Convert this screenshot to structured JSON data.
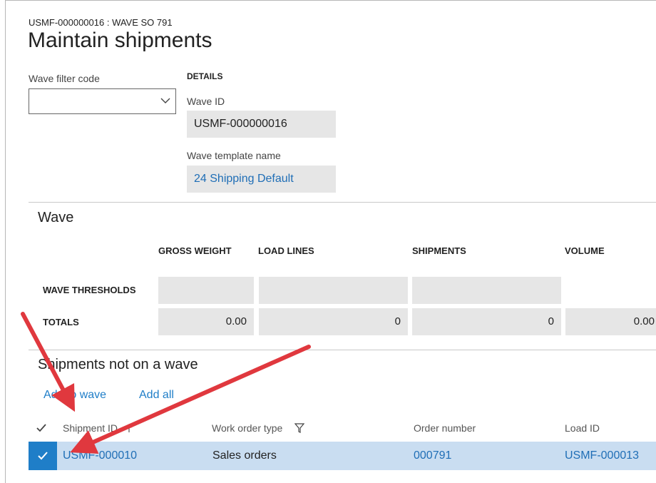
{
  "header": {
    "breadcrumb": "USMF-000000016 : WAVE SO 791",
    "title": "Maintain shipments"
  },
  "filter": {
    "label": "Wave filter code",
    "value": ""
  },
  "details": {
    "heading": "DETAILS",
    "wave_id_label": "Wave ID",
    "wave_id_value": "USMF-000000016",
    "template_label": "Wave template name",
    "template_value": "24 Shipping Default"
  },
  "wave": {
    "title": "Wave",
    "columns": [
      "GROSS WEIGHT",
      "LOAD LINES",
      "SHIPMENTS",
      "VOLUME"
    ],
    "rows": [
      {
        "label": "WAVE THRESHOLDS",
        "values": [
          "",
          "",
          "",
          ""
        ]
      },
      {
        "label": "TOTALS",
        "values": [
          "0.00",
          "0",
          "0",
          "0.00"
        ]
      }
    ]
  },
  "shipments": {
    "title": "Shipments not on a wave",
    "actions": {
      "add_to_wave": "Add to wave",
      "add_all": "Add all"
    },
    "columns": [
      "Shipment ID",
      "Work order type",
      "Order number",
      "Load ID"
    ],
    "rows": [
      {
        "shipment_id": "USMF-000010",
        "work_order_type": "Sales orders",
        "order_number": "000791",
        "load_id": "USMF-000013",
        "selected": true
      }
    ]
  },
  "colors": {
    "accent": "#1f7ec8",
    "selected_row": "#c9ddf1",
    "field_bg": "#e6e6e6",
    "annotation_arrow": "#e0383e"
  }
}
